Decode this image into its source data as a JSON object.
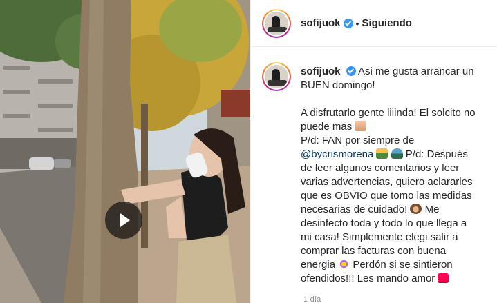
{
  "post": {
    "username": "sofijuok",
    "separator": "•",
    "follow_status": "Siguiendo",
    "caption_lines": {
      "l1": "Asi me gusta arrancar un",
      "l2": "BUEN domingo!",
      "l3": "A disfrutarlo gente liiinda! El solcito no",
      "l4": "puede mas",
      "l5": "P/d: FAN por siempre de",
      "l6_mention": "@bycrismorena",
      "l6_rest": "P/d: Después",
      "l7": "de leer algunos comentarios y leer",
      "l8": "varias advertencias, quiero aclararles",
      "l9": "que es OBVIO que tomo las medidas",
      "l10": "necesarias de cuidado!",
      "l10_rest": "Me",
      "l11": "desinfecto toda y todo lo que llega a",
      "l12": "mi casa! Simplemente elegi salir a",
      "l13": "comprar las facturas con buena",
      "l14": "energia",
      "l14_rest": "Perdón si se sintieron",
      "l15": "ofendidos!!! Les mando amor"
    },
    "timestamp": "1 día"
  },
  "icons": {
    "verified": "verified-badge-icon",
    "play": "play-icon",
    "emojis": [
      "hands-emoji",
      "woman-emoji",
      "car-emoji",
      "monkey-emoji",
      "sparkle-emoji",
      "heart-emoji"
    ]
  },
  "colors": {
    "verified": "#3897f0",
    "mention": "#00376b",
    "timestamp": "#8e8e8e"
  }
}
